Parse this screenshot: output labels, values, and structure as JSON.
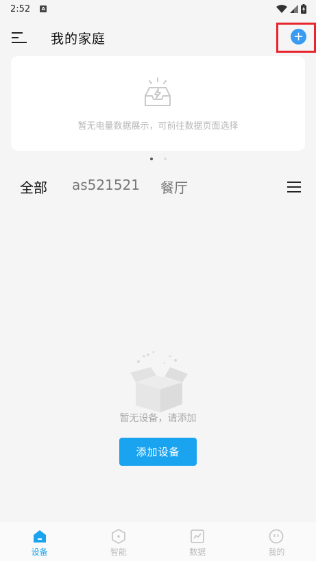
{
  "status_bar": {
    "time": "2:52",
    "notification_badge": "A"
  },
  "header": {
    "title": "我的家庭",
    "add_icon": "+"
  },
  "energy_card": {
    "empty_text": "暂无电量数据展示，可前往数据页面选择"
  },
  "pagination": {
    "count": 2,
    "active_index": 0
  },
  "room_tabs": [
    {
      "label": "全部",
      "active": true
    },
    {
      "label": "as521521",
      "active": false
    },
    {
      "label": "餐厅",
      "active": false
    }
  ],
  "empty_state": {
    "text": "暂无设备，请添加",
    "button_label": "添加设备"
  },
  "bottom_nav": [
    {
      "label": "设备",
      "icon": "device-home-icon",
      "active": true
    },
    {
      "label": "智能",
      "icon": "smart-hexagon-icon",
      "active": false
    },
    {
      "label": "数据",
      "icon": "data-chart-icon",
      "active": false
    },
    {
      "label": "我的",
      "icon": "profile-face-icon",
      "active": false
    }
  ],
  "colors": {
    "accent": "#1aa3ee",
    "add_button": "#3a9bf2",
    "highlight": "#e8242c"
  }
}
